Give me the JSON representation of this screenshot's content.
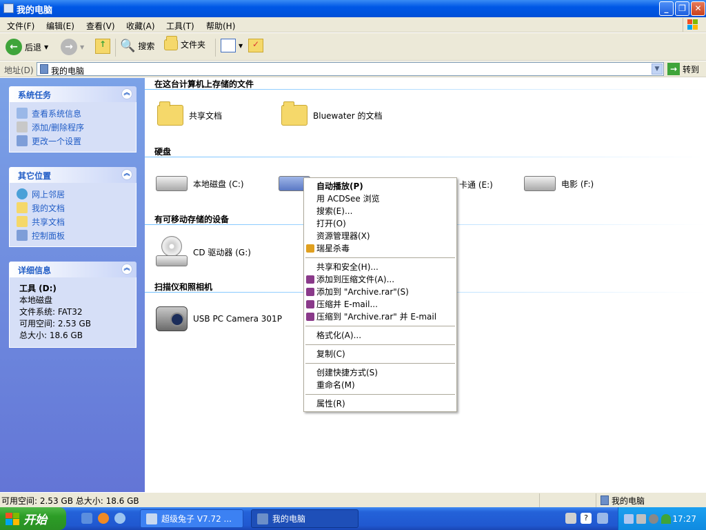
{
  "window": {
    "title": "我的电脑"
  },
  "menu": [
    "文件(F)",
    "编辑(E)",
    "查看(V)",
    "收藏(A)",
    "工具(T)",
    "帮助(H)"
  ],
  "toolbar": {
    "back": "后退",
    "search": "搜索",
    "folders": "文件夹"
  },
  "address": {
    "label": "地址(D)",
    "value": "我的电脑",
    "go": "转到"
  },
  "left": {
    "system_tasks": {
      "title": "系统任务",
      "items": [
        "查看系统信息",
        "添加/删除程序",
        "更改一个设置"
      ]
    },
    "other_places": {
      "title": "其它位置",
      "items": [
        "网上邻居",
        "我的文档",
        "共享文档",
        "控制面板"
      ]
    },
    "details": {
      "title": "详细信息",
      "name": "工具 (D:)",
      "type": "本地磁盘",
      "fs": "文件系统: FAT32",
      "free": "可用空间: 2.53 GB",
      "total": "总大小: 18.6 GB"
    }
  },
  "groups": {
    "stored": {
      "title": "在这台计算机上存储的文件",
      "items": [
        "共享文档",
        "Bluewater 的文档"
      ]
    },
    "hdd": {
      "title": "硬盘",
      "items": [
        "本地磁盘 (C:)",
        "卡通 (E:)",
        "电影 (F:)"
      ]
    },
    "removable": {
      "title": "有可移动存储的设备",
      "items": [
        "CD 驱动器 (G:)"
      ]
    },
    "scanners": {
      "title": "扫描仪和照相机",
      "items": [
        "USB PC Camera 301P"
      ]
    }
  },
  "context_menu": [
    {
      "label": "自动播放(P)",
      "bold": true
    },
    {
      "label": "用 ACDSee 浏览"
    },
    {
      "label": "搜索(E)..."
    },
    {
      "label": "打开(O)"
    },
    {
      "label": "资源管理器(X)"
    },
    {
      "label": "瑞星杀毒",
      "icon": "rising-antivirus-icon"
    },
    {
      "label": "共享和安全(H)..."
    },
    {
      "label": "添加到压缩文件(A)...",
      "icon": "winrar-icon"
    },
    {
      "label": "添加到 \"Archive.rar\"(S)",
      "icon": "winrar-icon"
    },
    {
      "label": "压缩并 E-mail...",
      "icon": "winrar-icon"
    },
    {
      "label": "压缩到 \"Archive.rar\" 并 E-mail",
      "icon": "winrar-icon"
    },
    {
      "label": "格式化(A)..."
    },
    {
      "label": "复制(C)"
    },
    {
      "label": "创建快捷方式(S)"
    },
    {
      "label": "重命名(M)"
    },
    {
      "label": "属性(R)"
    }
  ],
  "status": {
    "left": "可用空间: 2.53 GB 总大小: 18.6 GB",
    "right": "我的电脑"
  },
  "taskbar": {
    "start": "开始",
    "tasks": [
      "超级兔子 V7.72 ...",
      "我的电脑"
    ],
    "clock": "17:27"
  }
}
